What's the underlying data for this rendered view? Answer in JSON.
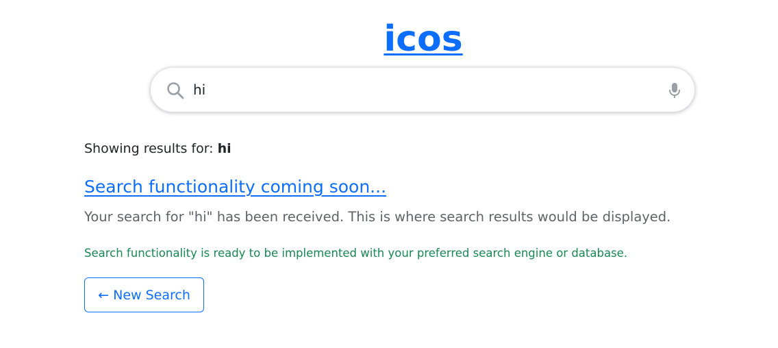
{
  "header": {
    "logo_text": "icos"
  },
  "search": {
    "value": "hi",
    "icon": "search-icon",
    "mic_icon": "microphone-icon"
  },
  "results": {
    "showing_prefix": "Showing results for:",
    "query": "hi",
    "title": "Search functionality coming soon...",
    "description": "Your search for \"hi\" has been received. This is where search results would be displayed.",
    "note": "Search functionality is ready to be implemented with your preferred search engine or database."
  },
  "actions": {
    "new_search_label": "← New Search"
  },
  "colors": {
    "link": "#0d6efd",
    "note": "#198754",
    "description": "#5f6368"
  }
}
